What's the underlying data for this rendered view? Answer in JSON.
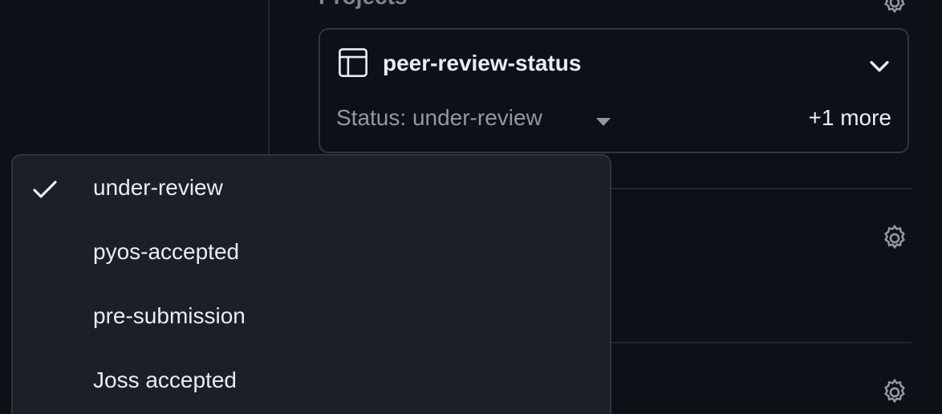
{
  "sidebar": {
    "section_title": "Projects"
  },
  "project": {
    "name": "peer-review-status",
    "status_field": "Status: under-review",
    "more": "+1 more"
  },
  "status_menu": {
    "options": [
      {
        "label": "under-review",
        "selected": true
      },
      {
        "label": "pyos-accepted",
        "selected": false
      },
      {
        "label": "pre-submission",
        "selected": false
      },
      {
        "label": "Joss accepted",
        "selected": false
      }
    ]
  },
  "icons": {
    "project": "table-icon",
    "expand": "chevron-down-icon",
    "status_caret": "triangle-down-icon",
    "settings": "gear-icon",
    "selected": "check-icon"
  },
  "colors": {
    "background": "#0d1117",
    "menu_background": "#1b1f27",
    "border": "#30363d",
    "text": "#e6edf3",
    "muted_text": "#9198a1"
  }
}
